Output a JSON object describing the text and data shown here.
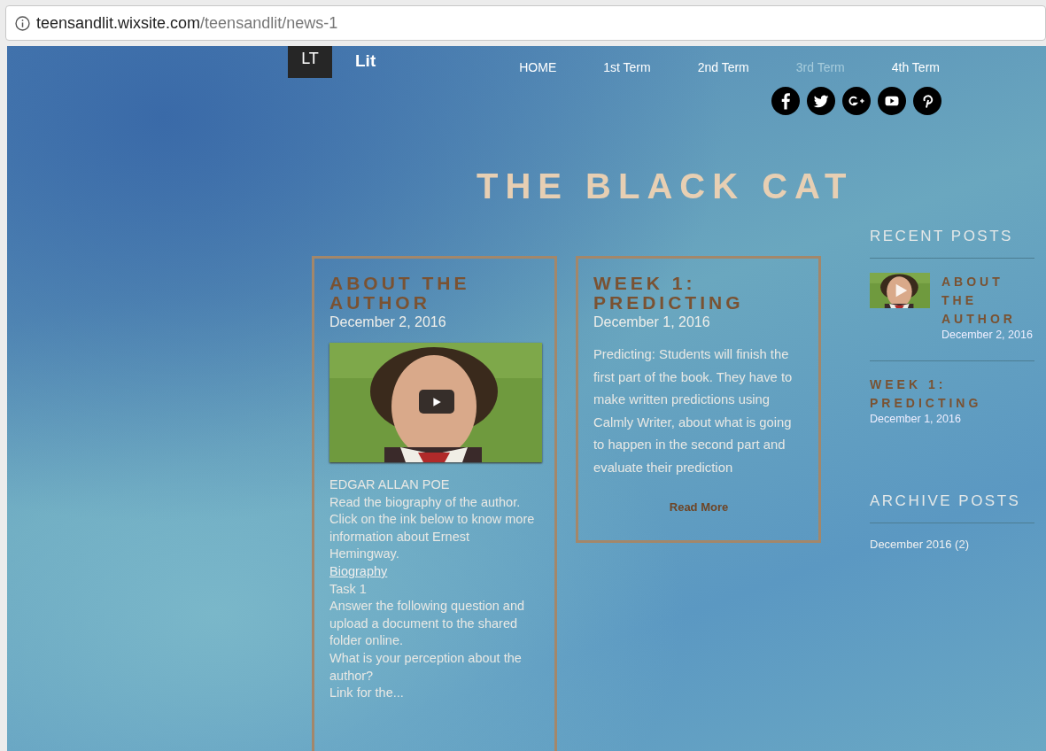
{
  "browser": {
    "url_host": "teensandlit.wixsite.com",
    "url_path": "/teensandlit/news-1"
  },
  "site": {
    "logo": "LT",
    "name": "Lit"
  },
  "nav": [
    {
      "label": "HOME",
      "selected": false
    },
    {
      "label": "1st Term",
      "selected": false
    },
    {
      "label": "2nd Term",
      "selected": false
    },
    {
      "label": "3rd Term",
      "selected": true
    },
    {
      "label": "4th Term",
      "selected": false
    }
  ],
  "social": [
    {
      "kind": "facebook"
    },
    {
      "kind": "twitter"
    },
    {
      "kind": "googleplus"
    },
    {
      "kind": "youtube"
    },
    {
      "kind": "pinterest"
    }
  ],
  "page_title": "THE BLACK CAT",
  "posts": [
    {
      "kind": "video",
      "title": "ABOUT THE AUTHOR",
      "date": "December 2, 2016",
      "body": [
        {
          "kind": "text",
          "text": "EDGAR ALLAN POE"
        },
        {
          "kind": "text",
          "text": "Read the biography of the author. Click on the ink below to know more information about Ernest Hemingway."
        },
        {
          "kind": "link",
          "text": "Biography"
        },
        {
          "kind": "text",
          "text": "Task 1"
        },
        {
          "kind": "text",
          "text": "Answer the following question and upload a document to the shared folder online."
        },
        {
          "kind": "text",
          "text": "What is your perception about the author?"
        },
        {
          "kind": "text",
          "text": "Link for the..."
        }
      ]
    },
    {
      "kind": "text",
      "title": "WEEK 1: PREDICTING",
      "date": "December 1, 2016",
      "excerpt": "Predicting: Students will finish the first part of the book. They have to make written predictions using Calmly Writer, about what is going to happen in the second part and evaluate their prediction",
      "read_more": "Read More"
    }
  ],
  "recent_posts": {
    "heading": "RECENT POSTS",
    "items": [
      {
        "kind": "video",
        "title": "ABOUT THE AUTHOR",
        "date": "December 2, 2016"
      },
      {
        "kind": "text",
        "title": "WEEK 1: PREDICTING",
        "date": "December 1, 2016"
      }
    ]
  },
  "archive_posts": {
    "heading": "ARCHIVE POSTS",
    "items": [
      "December 2016 (2)"
    ]
  }
}
